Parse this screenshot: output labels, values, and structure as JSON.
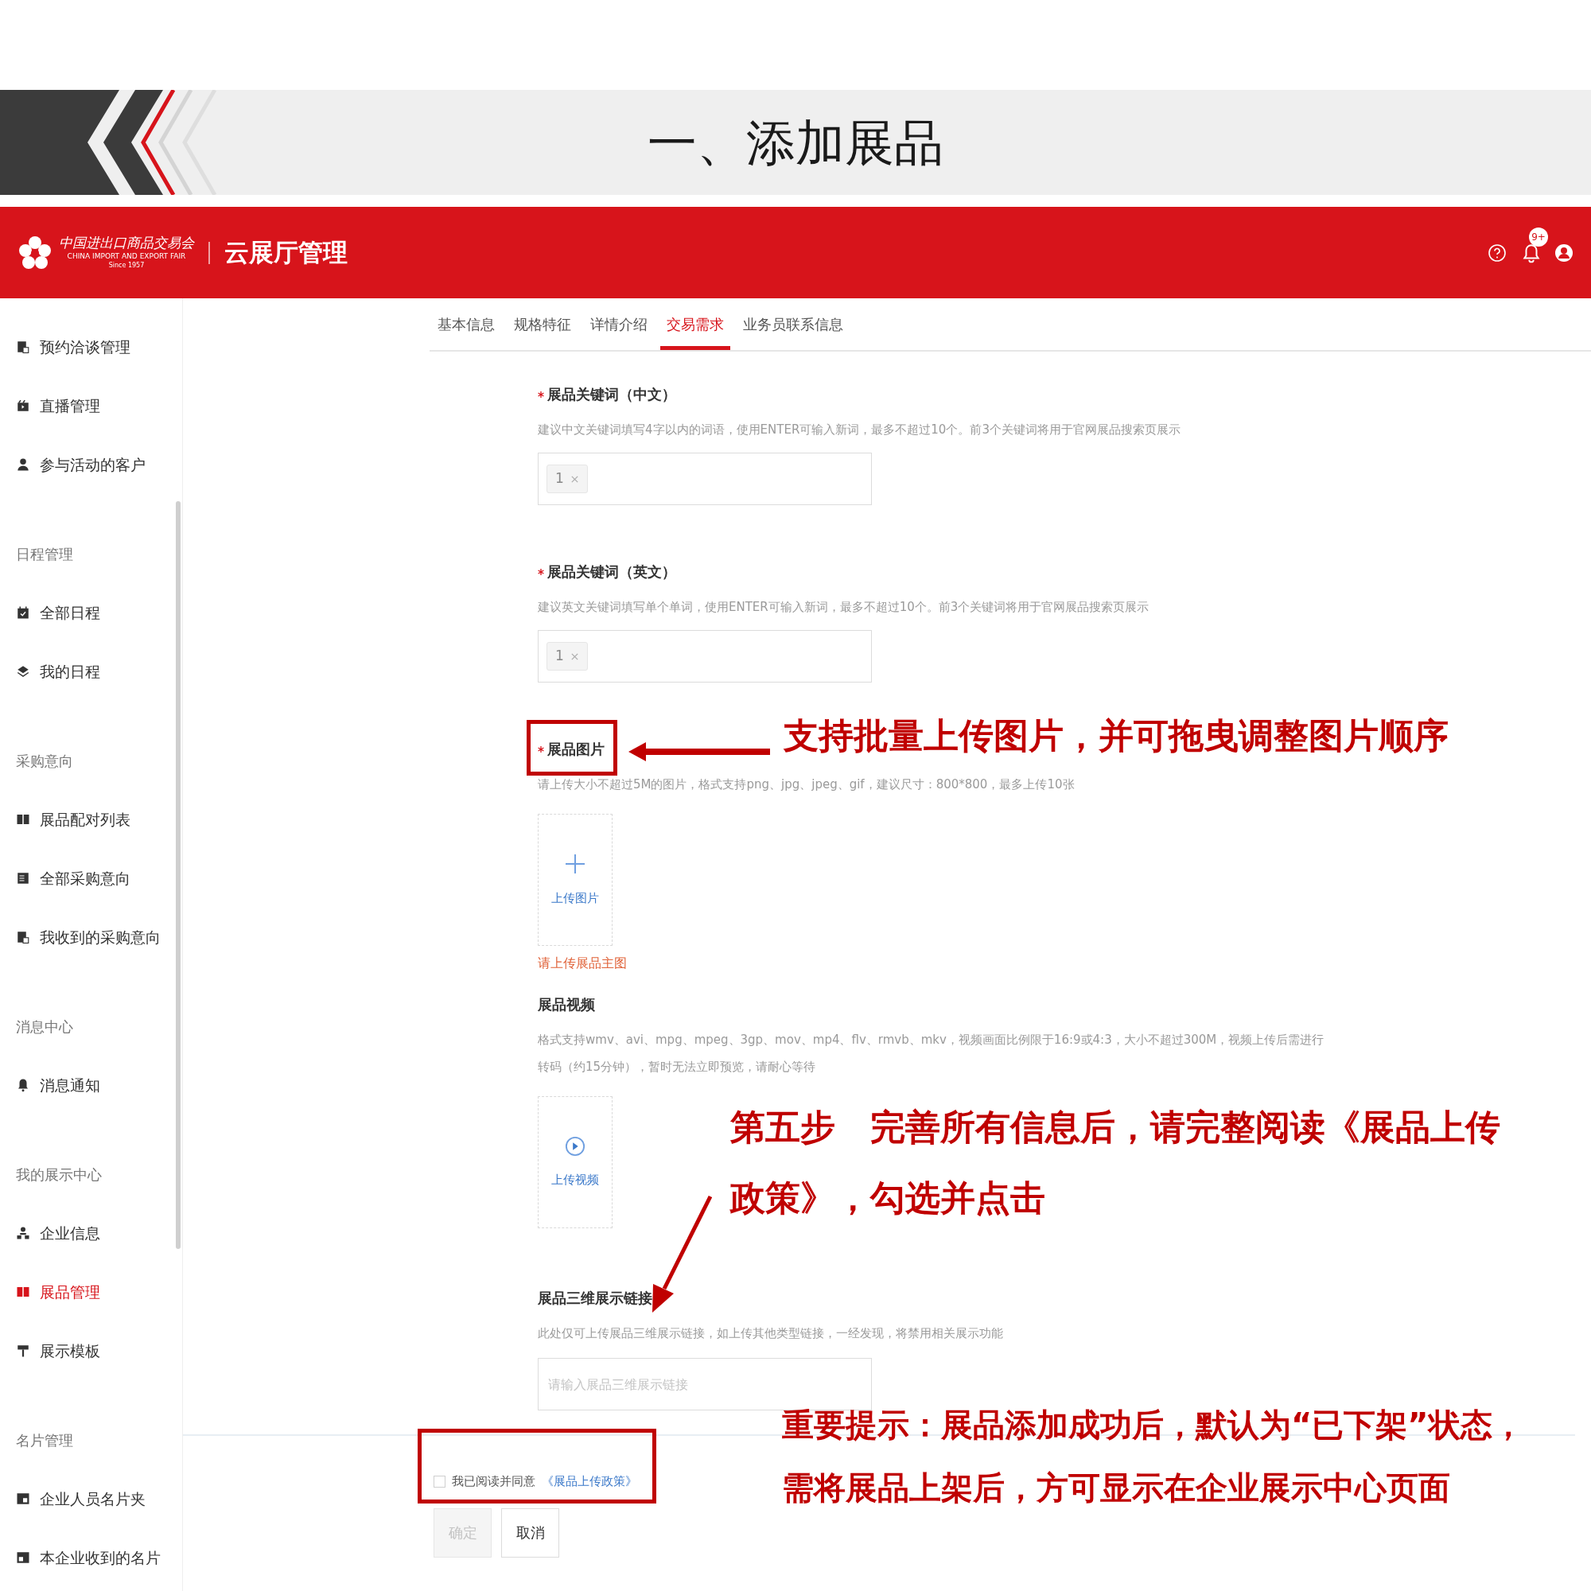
{
  "slide_title": "一、添加展品",
  "header": {
    "logo": {
      "name_cn": "中国进出口商品交易会",
      "name_en": "CHINA IMPORT AND EXPORT FAIR",
      "since": "Since 1957"
    },
    "app_title": "云展厅管理",
    "notification_badge": "9+"
  },
  "sidebar": {
    "sections": [
      {
        "items": [
          {
            "label": "预约洽谈管理",
            "selected": false
          },
          {
            "label": "直播管理",
            "selected": false
          },
          {
            "label": "参与活动的客户",
            "selected": false
          }
        ]
      },
      {
        "heading": "日程管理",
        "items": [
          {
            "label": "全部日程",
            "selected": false
          },
          {
            "label": "我的日程",
            "selected": false
          }
        ]
      },
      {
        "heading": "采购意向",
        "items": [
          {
            "label": "展品配对列表",
            "selected": false
          },
          {
            "label": "全部采购意向",
            "selected": false
          },
          {
            "label": "我收到的采购意向",
            "selected": false
          }
        ]
      },
      {
        "heading": "消息中心",
        "items": [
          {
            "label": "消息通知",
            "selected": false
          }
        ]
      },
      {
        "heading": "我的展示中心",
        "items": [
          {
            "label": "企业信息",
            "selected": false
          },
          {
            "label": "展品管理",
            "selected": true
          },
          {
            "label": "展示模板",
            "selected": false
          }
        ]
      },
      {
        "heading": "名片管理",
        "items": [
          {
            "label": "企业人员名片夹",
            "selected": false
          },
          {
            "label": "本企业收到的名片",
            "selected": false
          }
        ]
      }
    ]
  },
  "tabs": [
    {
      "label": "基本信息",
      "selected": false
    },
    {
      "label": "规格特征",
      "selected": false
    },
    {
      "label": "详情介绍",
      "selected": false
    },
    {
      "label": "交易需求",
      "selected": true
    },
    {
      "label": "业务员联系信息",
      "selected": false
    }
  ],
  "form": {
    "fields": [
      {
        "kind": "tags",
        "label": "展品关键词（中文）",
        "required": true,
        "hint": "建议中文关键词填写4字以内的词语，使用ENTER可输入新词，最多不超过10个。前3个关键词将用于官网展品搜索页展示",
        "tags": [
          "1"
        ]
      },
      {
        "kind": "tags",
        "label": "展品关键词（英文）",
        "required": true,
        "hint": "建议英文关键词填写单个单词，使用ENTER可输入新词，最多不超过10个。前3个关键词将用于官网展品搜索页展示",
        "tags": [
          "1"
        ]
      },
      {
        "kind": "image_upload",
        "label": "展品图片",
        "required": true,
        "hint": "请上传大小不超过5M的图片，格式支持png、jpg、jpeg、gif，建议尺寸：800*800，最多上传10张",
        "button_label": "上传图片",
        "error": "请上传展品主图"
      },
      {
        "kind": "video_upload",
        "label": "展品视频",
        "required": false,
        "hint": "格式支持wmv、avi、mpg、mpeg、3gp、mov、mp4、flv、rmvb、mkv，视频画面比例限于16:9或4:3，大小不超过300M，视频上传后需进行转码（约15分钟），暂时无法立即预览，请耐心等待",
        "button_label": "上传视频"
      },
      {
        "kind": "text",
        "label": "展品三维展示链接",
        "required": false,
        "hint": "此处仅可上传展品三维展示链接，如上传其他类型链接，一经发现，将禁用相关展示功能",
        "placeholder": "请输入展品三维展示链接"
      }
    ]
  },
  "agreement": {
    "checked": false,
    "text": "我已阅读并同意",
    "link": "《展品上传政策》"
  },
  "buttons": [
    {
      "label": "确定",
      "disabled": true
    },
    {
      "label": "取消",
      "disabled": false
    }
  ],
  "annotations": [
    {
      "lines": [
        "支持批量上传图片，并可拖曳调整图片顺序"
      ]
    },
    {
      "lines": [
        "第五步　完善所有信息后，请完整阅读《展品上传",
        "政策》，勾选并点击"
      ]
    },
    {
      "lines": [
        "重要提示：展品添加成功后，默认为“已下架”状态，",
        "需将展品上架后，方可显示在企业展示中心页面"
      ]
    }
  ]
}
